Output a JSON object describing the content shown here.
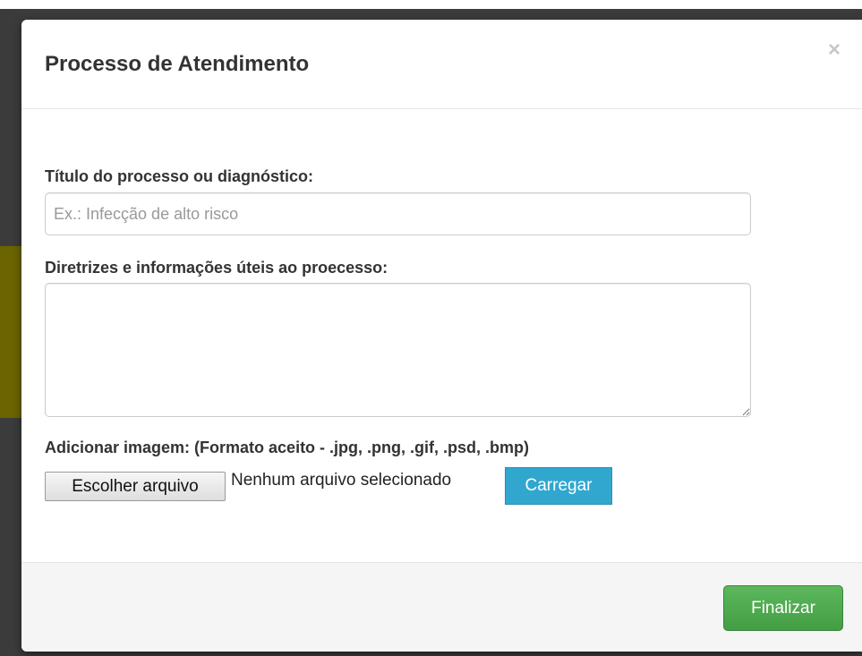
{
  "modal": {
    "title": "Processo de Atendimento",
    "close_label": "×"
  },
  "form": {
    "title_field": {
      "label": "Título do processo ou diagnóstico:",
      "placeholder": "Ex.: Infecção de alto risco",
      "value": ""
    },
    "guidelines_field": {
      "label": "Diretrizes e informações úteis ao proecesso:",
      "value": ""
    },
    "image_upload": {
      "label": "Adicionar imagem: (Formato aceito - .jpg, .png, .gif, .psd, .bmp)",
      "choose_button_label": "Escolher arquivo",
      "file_status": "Nenhum arquivo selecionado",
      "upload_button_label": "Carregar"
    }
  },
  "footer": {
    "finish_button_label": "Finalizar"
  },
  "colors": {
    "upload_button": "#31a7cf",
    "finish_button": "#5cb85c",
    "backdrop": "#3b3b3b"
  }
}
